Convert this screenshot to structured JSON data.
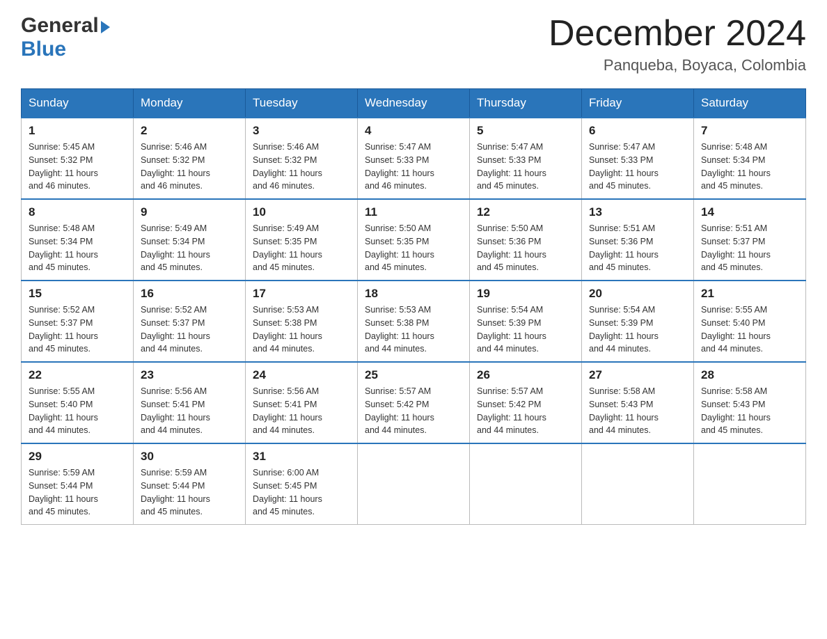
{
  "header": {
    "title": "December 2024",
    "subtitle": "Panqueba, Boyaca, Colombia",
    "logo_general": "General",
    "logo_blue": "Blue"
  },
  "calendar": {
    "days_of_week": [
      "Sunday",
      "Monday",
      "Tuesday",
      "Wednesday",
      "Thursday",
      "Friday",
      "Saturday"
    ],
    "weeks": [
      [
        {
          "num": "1",
          "info": "Sunrise: 5:45 AM\nSunset: 5:32 PM\nDaylight: 11 hours\nand 46 minutes."
        },
        {
          "num": "2",
          "info": "Sunrise: 5:46 AM\nSunset: 5:32 PM\nDaylight: 11 hours\nand 46 minutes."
        },
        {
          "num": "3",
          "info": "Sunrise: 5:46 AM\nSunset: 5:32 PM\nDaylight: 11 hours\nand 46 minutes."
        },
        {
          "num": "4",
          "info": "Sunrise: 5:47 AM\nSunset: 5:33 PM\nDaylight: 11 hours\nand 46 minutes."
        },
        {
          "num": "5",
          "info": "Sunrise: 5:47 AM\nSunset: 5:33 PM\nDaylight: 11 hours\nand 45 minutes."
        },
        {
          "num": "6",
          "info": "Sunrise: 5:47 AM\nSunset: 5:33 PM\nDaylight: 11 hours\nand 45 minutes."
        },
        {
          "num": "7",
          "info": "Sunrise: 5:48 AM\nSunset: 5:34 PM\nDaylight: 11 hours\nand 45 minutes."
        }
      ],
      [
        {
          "num": "8",
          "info": "Sunrise: 5:48 AM\nSunset: 5:34 PM\nDaylight: 11 hours\nand 45 minutes."
        },
        {
          "num": "9",
          "info": "Sunrise: 5:49 AM\nSunset: 5:34 PM\nDaylight: 11 hours\nand 45 minutes."
        },
        {
          "num": "10",
          "info": "Sunrise: 5:49 AM\nSunset: 5:35 PM\nDaylight: 11 hours\nand 45 minutes."
        },
        {
          "num": "11",
          "info": "Sunrise: 5:50 AM\nSunset: 5:35 PM\nDaylight: 11 hours\nand 45 minutes."
        },
        {
          "num": "12",
          "info": "Sunrise: 5:50 AM\nSunset: 5:36 PM\nDaylight: 11 hours\nand 45 minutes."
        },
        {
          "num": "13",
          "info": "Sunrise: 5:51 AM\nSunset: 5:36 PM\nDaylight: 11 hours\nand 45 minutes."
        },
        {
          "num": "14",
          "info": "Sunrise: 5:51 AM\nSunset: 5:37 PM\nDaylight: 11 hours\nand 45 minutes."
        }
      ],
      [
        {
          "num": "15",
          "info": "Sunrise: 5:52 AM\nSunset: 5:37 PM\nDaylight: 11 hours\nand 45 minutes."
        },
        {
          "num": "16",
          "info": "Sunrise: 5:52 AM\nSunset: 5:37 PM\nDaylight: 11 hours\nand 44 minutes."
        },
        {
          "num": "17",
          "info": "Sunrise: 5:53 AM\nSunset: 5:38 PM\nDaylight: 11 hours\nand 44 minutes."
        },
        {
          "num": "18",
          "info": "Sunrise: 5:53 AM\nSunset: 5:38 PM\nDaylight: 11 hours\nand 44 minutes."
        },
        {
          "num": "19",
          "info": "Sunrise: 5:54 AM\nSunset: 5:39 PM\nDaylight: 11 hours\nand 44 minutes."
        },
        {
          "num": "20",
          "info": "Sunrise: 5:54 AM\nSunset: 5:39 PM\nDaylight: 11 hours\nand 44 minutes."
        },
        {
          "num": "21",
          "info": "Sunrise: 5:55 AM\nSunset: 5:40 PM\nDaylight: 11 hours\nand 44 minutes."
        }
      ],
      [
        {
          "num": "22",
          "info": "Sunrise: 5:55 AM\nSunset: 5:40 PM\nDaylight: 11 hours\nand 44 minutes."
        },
        {
          "num": "23",
          "info": "Sunrise: 5:56 AM\nSunset: 5:41 PM\nDaylight: 11 hours\nand 44 minutes."
        },
        {
          "num": "24",
          "info": "Sunrise: 5:56 AM\nSunset: 5:41 PM\nDaylight: 11 hours\nand 44 minutes."
        },
        {
          "num": "25",
          "info": "Sunrise: 5:57 AM\nSunset: 5:42 PM\nDaylight: 11 hours\nand 44 minutes."
        },
        {
          "num": "26",
          "info": "Sunrise: 5:57 AM\nSunset: 5:42 PM\nDaylight: 11 hours\nand 44 minutes."
        },
        {
          "num": "27",
          "info": "Sunrise: 5:58 AM\nSunset: 5:43 PM\nDaylight: 11 hours\nand 44 minutes."
        },
        {
          "num": "28",
          "info": "Sunrise: 5:58 AM\nSunset: 5:43 PM\nDaylight: 11 hours\nand 45 minutes."
        }
      ],
      [
        {
          "num": "29",
          "info": "Sunrise: 5:59 AM\nSunset: 5:44 PM\nDaylight: 11 hours\nand 45 minutes."
        },
        {
          "num": "30",
          "info": "Sunrise: 5:59 AM\nSunset: 5:44 PM\nDaylight: 11 hours\nand 45 minutes."
        },
        {
          "num": "31",
          "info": "Sunrise: 6:00 AM\nSunset: 5:45 PM\nDaylight: 11 hours\nand 45 minutes."
        },
        {
          "num": "",
          "info": ""
        },
        {
          "num": "",
          "info": ""
        },
        {
          "num": "",
          "info": ""
        },
        {
          "num": "",
          "info": ""
        }
      ]
    ]
  }
}
